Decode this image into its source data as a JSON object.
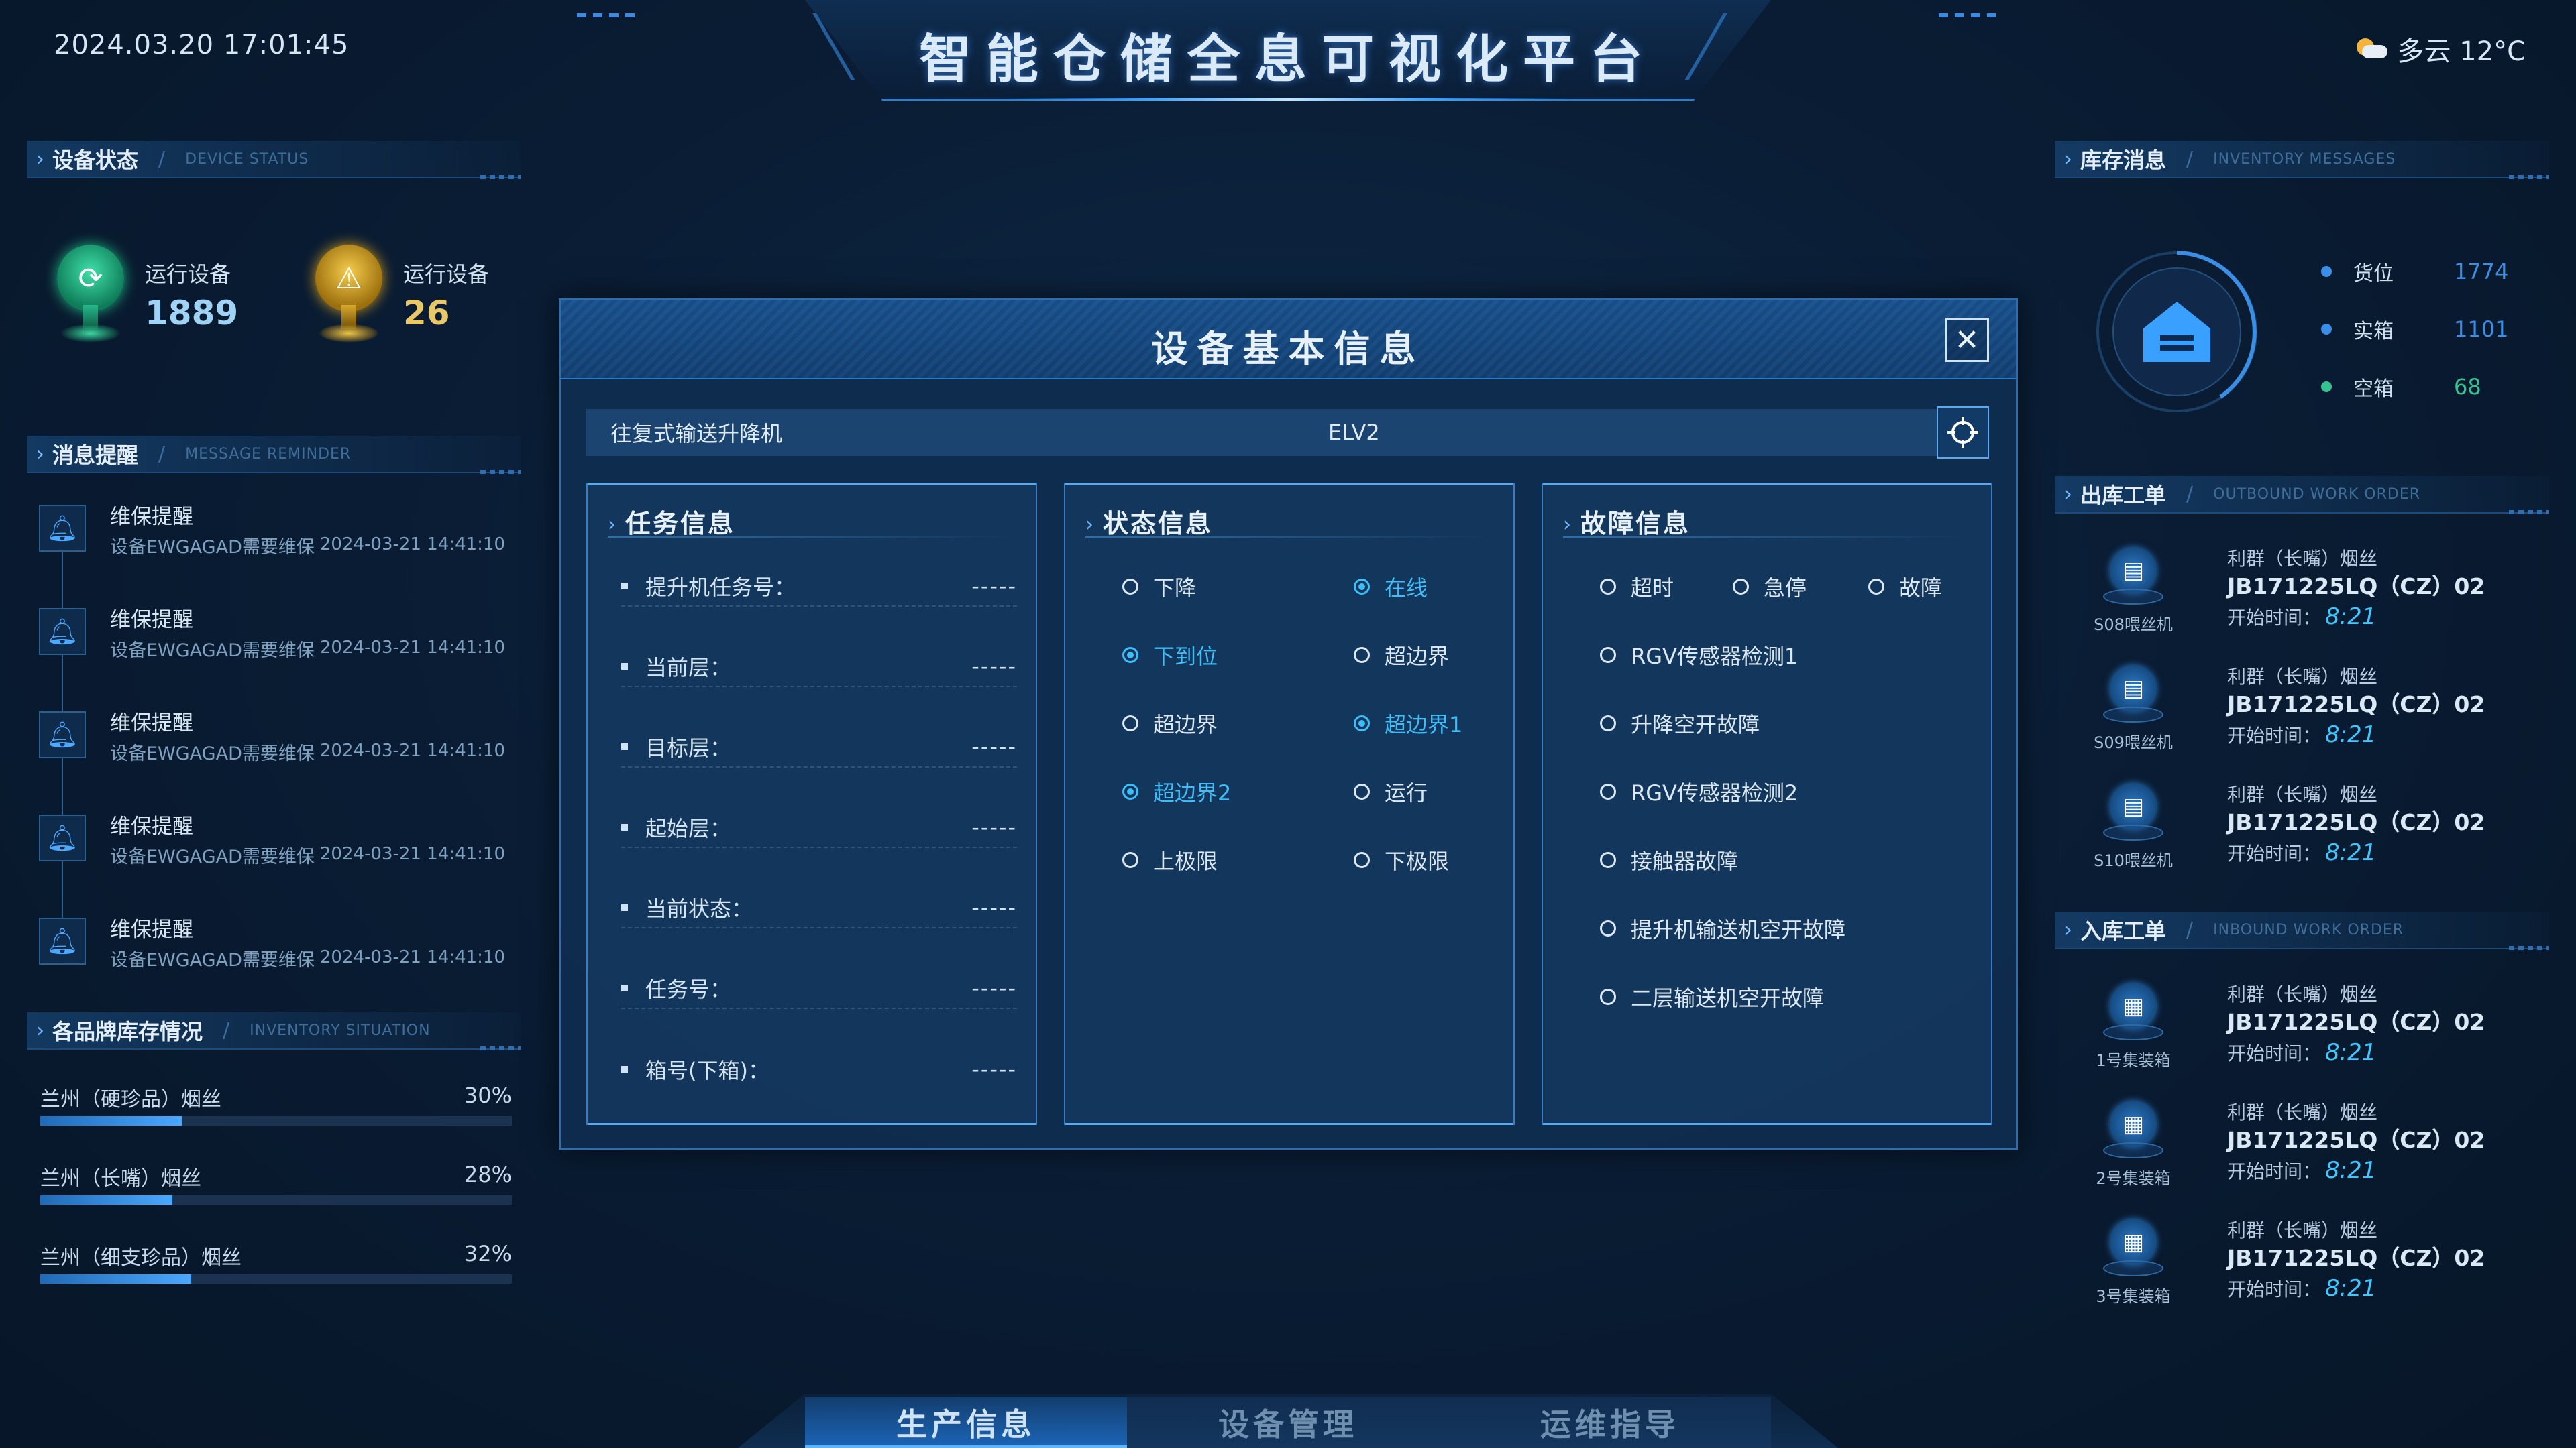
{
  "header": {
    "datetime": "2024.03.20 17:01:45",
    "title": "智能仓储全息可视化平台",
    "weather": {
      "icon": "partly-cloudy-icon",
      "text": "多云 12°C"
    }
  },
  "device_status": {
    "title": "设备状态",
    "title_en": "DEVICE STATUS",
    "items": [
      {
        "label": "运行设备",
        "value": "1889",
        "color": "#49d3a0",
        "icon": "running-device-icon"
      },
      {
        "label": "运行设备",
        "value": "26",
        "color": "#e6c15a",
        "icon": "warning-device-icon"
      }
    ]
  },
  "messages": {
    "title": "消息提醒",
    "title_en": "MESSAGE REMINDER",
    "items": [
      {
        "title": "维保提醒",
        "sub": "设备EWGAGAD需要维保",
        "time": "2024-03-21  14:41:10"
      },
      {
        "title": "维保提醒",
        "sub": "设备EWGAGAD需要维保",
        "time": "2024-03-21  14:41:10"
      },
      {
        "title": "维保提醒",
        "sub": "设备EWGAGAD需要维保",
        "time": "2024-03-21  14:41:10"
      },
      {
        "title": "维保提醒",
        "sub": "设备EWGAGAD需要维保",
        "time": "2024-03-21  14:41:10"
      },
      {
        "title": "维保提醒",
        "sub": "设备EWGAGAD需要维保",
        "time": "2024-03-21  14:41:10"
      }
    ]
  },
  "brand_inventory": {
    "title": "各品牌库存情况",
    "title_en": "INVENTORY SITUATION",
    "items": [
      {
        "name": "兰州（硬珍品）烟丝",
        "percent_label": "30%",
        "percent": 30
      },
      {
        "name": "兰州（长嘴）烟丝",
        "percent_label": "28%",
        "percent": 28
      },
      {
        "name": "兰州（细支珍品）烟丝",
        "percent_label": "32%",
        "percent": 32
      }
    ]
  },
  "inventory_messages": {
    "title": "库存消息",
    "title_en": "INVENTORY MESSAGES",
    "icon": "warehouse-icon",
    "stats": [
      {
        "label": "货位",
        "value": "1774",
        "color": "#3a8ee6"
      },
      {
        "label": "实箱",
        "value": "1101",
        "color": "#3a8ee6"
      },
      {
        "label": "空箱",
        "value": "68",
        "color": "#34c38f"
      }
    ]
  },
  "outbound": {
    "title": "出库工单",
    "title_en": "OUTBOUND WORK ORDER",
    "items": [
      {
        "machine": "S08喂丝机",
        "brand": "利群（长嘴）烟丝",
        "code": "JB171225LQ（CZ）02",
        "time_label": "开始时间：",
        "time": "8:21"
      },
      {
        "machine": "S09喂丝机",
        "brand": "利群（长嘴）烟丝",
        "code": "JB171225LQ（CZ）02",
        "time_label": "开始时间：",
        "time": "8:21"
      },
      {
        "machine": "S10喂丝机",
        "brand": "利群（长嘴）烟丝",
        "code": "JB171225LQ（CZ）02",
        "time_label": "开始时间：",
        "time": "8:21"
      }
    ]
  },
  "inbound": {
    "title": "入库工单",
    "title_en": "INBOUND WORK ORDER",
    "items": [
      {
        "machine": "1号集装箱",
        "brand": "利群（长嘴）烟丝",
        "code": "JB171225LQ（CZ）02",
        "time_label": "开始时间：",
        "time": "8:21"
      },
      {
        "machine": "2号集装箱",
        "brand": "利群（长嘴）烟丝",
        "code": "JB171225LQ（CZ）02",
        "time_label": "开始时间：",
        "time": "8:21"
      },
      {
        "machine": "3号集装箱",
        "brand": "利群（长嘴）烟丝",
        "code": "JB171225LQ（CZ）02",
        "time_label": "开始时间：",
        "time": "8:21"
      }
    ]
  },
  "bottom_tabs": [
    {
      "label": "生产信息",
      "active": true
    },
    {
      "label": "设备管理",
      "active": false
    },
    {
      "label": "运维指导",
      "active": false
    }
  ],
  "modal": {
    "title": "设备基本信息",
    "close_icon": "close-icon",
    "device_type": "往复式输送升降机",
    "device_id": "ELV2",
    "locate_icon": "crosshair-icon",
    "task_panel": {
      "title": "任务信息",
      "rows": [
        {
          "label": "提升机任务号：",
          "value": "-----"
        },
        {
          "label": "当前层：",
          "value": "-----"
        },
        {
          "label": "目标层：",
          "value": "-----"
        },
        {
          "label": "起始层：",
          "value": "-----"
        },
        {
          "label": "当前状态：",
          "value": "-----"
        },
        {
          "label": "任务号：",
          "value": "-----"
        },
        {
          "label": "箱号(下箱)：",
          "value": "-----"
        }
      ]
    },
    "status_panel": {
      "title": "状态信息",
      "options": [
        {
          "label": "下降",
          "checked": false
        },
        {
          "label": "在线",
          "checked": true
        },
        {
          "label": "下到位",
          "checked": true
        },
        {
          "label": "超边界",
          "checked": false
        },
        {
          "label": "超边界",
          "checked": false
        },
        {
          "label": "超边界1",
          "checked": true
        },
        {
          "label": "超边界2",
          "checked": true
        },
        {
          "label": "运行",
          "checked": false
        },
        {
          "label": "上极限",
          "checked": false
        },
        {
          "label": "下极限",
          "checked": false
        }
      ]
    },
    "fault_panel": {
      "title": "故障信息",
      "options": [
        {
          "label": "超时",
          "checked": false
        },
        {
          "label": "急停",
          "checked": false
        },
        {
          "label": "故障",
          "checked": false
        },
        {
          "label": "RGV传感器检测1",
          "checked": false
        },
        {
          "label": "升降空开故障",
          "checked": false
        },
        {
          "label": "RGV传感器检测2",
          "checked": false
        },
        {
          "label": "接触器故障",
          "checked": false
        },
        {
          "label": "提升机输送机空开故障",
          "checked": false
        },
        {
          "label": "二层输送机空开故障",
          "checked": false
        }
      ]
    }
  }
}
